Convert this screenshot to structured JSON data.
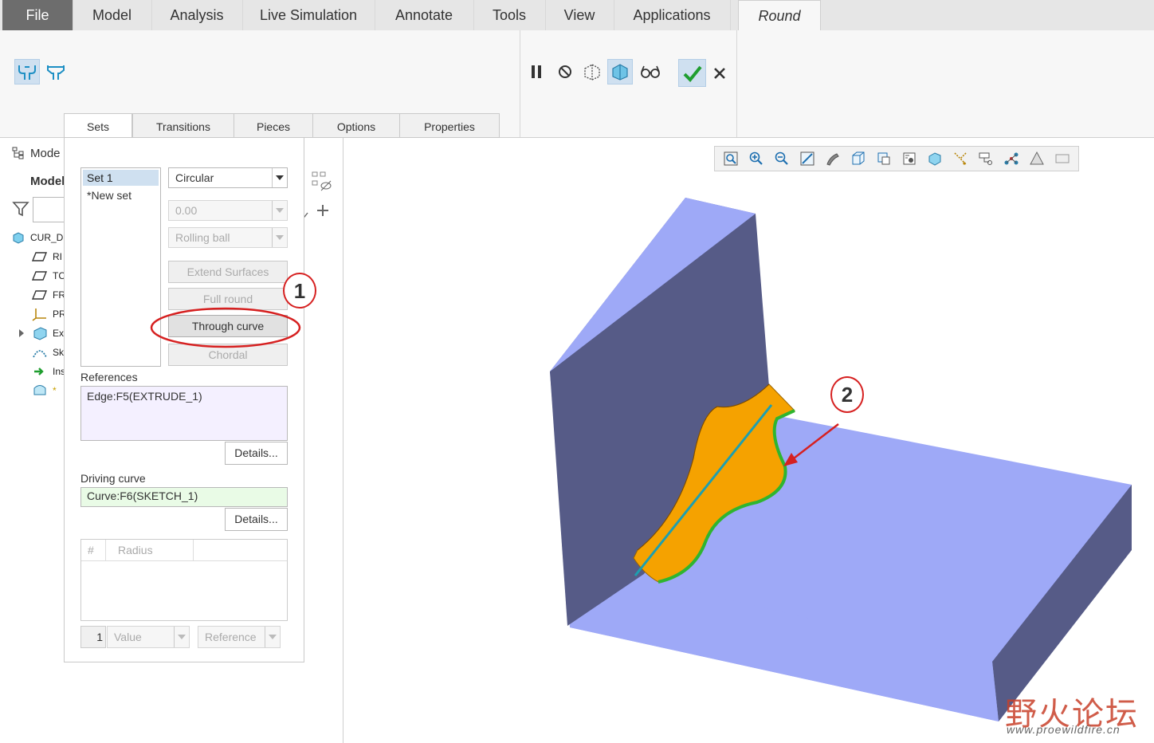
{
  "menubar": {
    "file": "File",
    "model": "Model",
    "analysis": "Analysis",
    "live_simulation": "Live Simulation",
    "annotate": "Annotate",
    "tools": "Tools",
    "view": "View",
    "applications": "Applications",
    "round": "Round"
  },
  "tree": {
    "header": "Mode",
    "title": "Model",
    "items": [
      {
        "label": "CUR_D",
        "icon": "part-icon"
      },
      {
        "label": "RI",
        "icon": "datum-plane-icon"
      },
      {
        "label": "TC",
        "icon": "datum-plane-icon"
      },
      {
        "label": "FR",
        "icon": "datum-plane-icon"
      },
      {
        "label": "PR",
        "icon": "coordinate-system-icon"
      },
      {
        "label": "Ex",
        "icon": "extrude-icon"
      },
      {
        "label": "Sk",
        "icon": "sketch-icon"
      },
      {
        "label": "Ins",
        "icon": "insert-here-icon"
      },
      {
        "label": "*",
        "icon": "round-feature-icon"
      }
    ]
  },
  "panel": {
    "tabs": [
      "Sets",
      "Transitions",
      "Pieces",
      "Options",
      "Properties"
    ],
    "sets": [
      "Set 1",
      "*New set"
    ],
    "shape": "Circular",
    "value": "0.00",
    "method": "Rolling ball",
    "extend_surfaces": "Extend Surfaces",
    "full_round": "Full round",
    "through_curve": "Through curve",
    "chordal": "Chordal",
    "references_label": "References",
    "references_value": "Edge:F5(EXTRUDE_1)",
    "details": "Details...",
    "driving_curve_label": "Driving curve",
    "driving_curve_value": "Curve:F6(SKETCH_1)",
    "radius_col_hash": "#",
    "radius_col_radius": "Radius",
    "radius_count": "1",
    "value_dd": "Value",
    "reference_dd": "Reference"
  },
  "annotations": {
    "one": "1",
    "two": "2"
  },
  "watermark": {
    "title": "野火论坛",
    "url": "www.proewildfire.cn"
  },
  "colors": {
    "accent_red": "#d62020",
    "model_face_light": "#9ea9f7",
    "model_face_dark": "#565b87",
    "round_surface": "#f5a200",
    "driving_curve_green": "#2fb52f",
    "edge_cyan": "#1d9fb0",
    "selection_blue": "#cfe0f0",
    "driving_curve_field": "#e9fbe6",
    "references_field": "#f4f0ff"
  }
}
